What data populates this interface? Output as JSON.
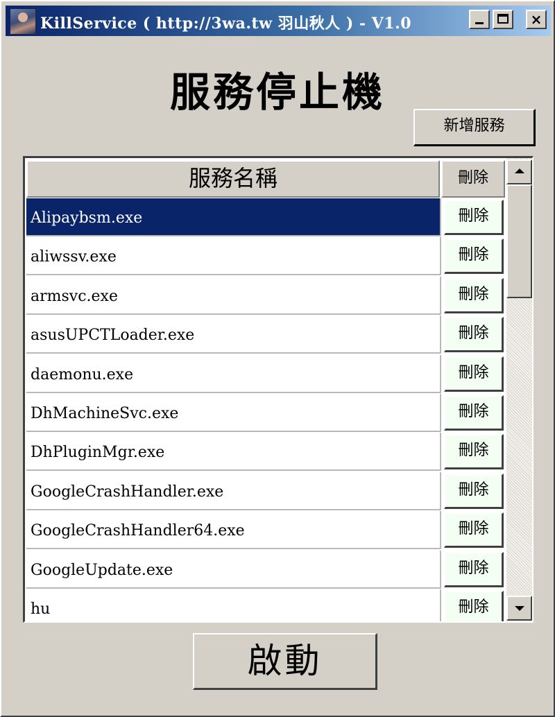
{
  "window": {
    "title": "KillService ( http://3wa.tw 羽山秋人 ) - V1.0",
    "icon": "app-avatar-icon",
    "controls": {
      "minimize": "minimize-icon",
      "maximize": "maximize-icon",
      "close": "×"
    }
  },
  "heading": "服務停止機",
  "add_button_label": "新增服務",
  "table": {
    "col_name_header": "服務名稱",
    "col_delete_header": "刪除",
    "delete_label": "刪除",
    "selected_index": 0,
    "rows": [
      "Alipaybsm.exe",
      "aliwssv.exe",
      "armsvc.exe",
      "asusUPCTLoader.exe",
      "daemonu.exe",
      "DhMachineSvc.exe",
      "DhPluginMgr.exe",
      "GoogleCrashHandler.exe",
      "GoogleCrashHandler64.exe",
      "GoogleUpdate.exe",
      "hu"
    ]
  },
  "start_button_label": "啟動",
  "colors": {
    "titlebar_start": "#0a246a",
    "titlebar_end": "#a6caf0",
    "selection": "#0a246a",
    "delete_button_bg": "#f2fff2",
    "face": "#d4d0c8"
  }
}
